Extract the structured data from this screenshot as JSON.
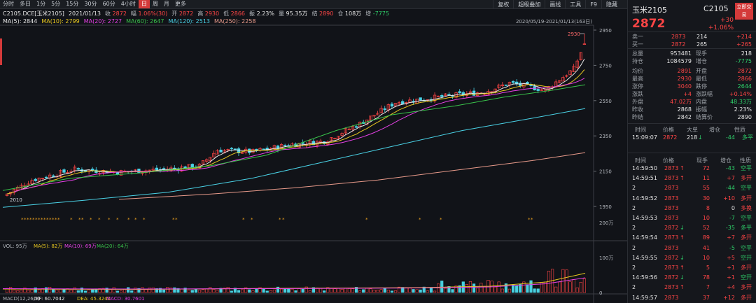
{
  "toolbar": {
    "periods": [
      "分时",
      "多日",
      "1分",
      "5分",
      "15分",
      "30分",
      "60分",
      "4小时",
      "日",
      "周",
      "月",
      "更多"
    ],
    "active_period": "日",
    "tools": [
      "复权",
      "超级叠加",
      "画线",
      "工具",
      "F9",
      "隐藏"
    ]
  },
  "quote": {
    "contract": "C2105.DCE[玉米2105]",
    "date": "2021/01/13",
    "close_label": "收",
    "close": "2872",
    "change_label": "幅",
    "change": "1.06%(30)",
    "open_label": "开",
    "open": "2872",
    "high_label": "高",
    "high": "2930",
    "low_label": "低",
    "low": "2866",
    "amp_label": "振",
    "amp": "2.23%",
    "vol_label": "量",
    "vol": "95.35万",
    "settle_label": "结",
    "settle": "2890",
    "oi_label": "仓",
    "oi": "108万",
    "oichg_label": "增",
    "oichg": "-7775"
  },
  "ma_legend": [
    "MA(5): 2844",
    "MA(10): 2799",
    "MA(20): 2727",
    "MA(60): 2647",
    "MA(120): 2513",
    "MA(250): 2258"
  ],
  "range_label": "2020/05/19-2021/01/13(163日)",
  "price_axis": [
    "2950",
    "2750",
    "2550",
    "2350",
    "2150",
    "1950"
  ],
  "annotations": {
    "high_mark": "2930",
    "low_mark": "2010"
  },
  "volume_legend": [
    "VOL: 95万",
    "MA(5): 82万",
    "MA(10): 69万",
    "MA(20): 64万"
  ],
  "volume_axis": [
    "200万",
    "100万",
    "0"
  ],
  "macd_legend": [
    "MACD(12,26,9)",
    "DIF: 60.7042",
    "DEA: 45.3241",
    "MACD: 30.7601"
  ],
  "colors": {
    "up": "#ff4545",
    "down": "#2ed06a",
    "ma5": "#e6e6e6",
    "ma10": "#e8c820",
    "ma20": "#e640e6",
    "ma60": "#39c24a",
    "ma120": "#4ad2e6",
    "ma250": "#e89a8a",
    "vol_up": "#ff4545",
    "vol_down": "#48d0e0"
  },
  "panel": {
    "name": "玉米2105",
    "code": "C2105",
    "price": "2872",
    "change": "+30",
    "change_pct": "+1.06%",
    "trade_button": "立即交易",
    "bid_ask": [
      {
        "label": "卖一",
        "price": "2873",
        "vol": "214",
        "chg": "+214"
      },
      {
        "label": "买一",
        "price": "2872",
        "vol": "265",
        "chg": "+265"
      }
    ],
    "stats_left": [
      {
        "label": "总量",
        "value": "953481",
        "cls": "white"
      },
      {
        "label": "持仓",
        "value": "1084579",
        "cls": "white"
      },
      {
        "label": "均价",
        "value": "2891",
        "cls": "red"
      },
      {
        "label": "最高",
        "value": "2930",
        "cls": "red"
      },
      {
        "label": "涨停",
        "value": "3040",
        "cls": "red"
      },
      {
        "label": "涨跌",
        "value": "+4",
        "cls": "red"
      },
      {
        "label": "外盘",
        "value": "47.02万",
        "cls": "red"
      },
      {
        "label": "昨收",
        "value": "2868",
        "cls": "white"
      },
      {
        "label": "昨结",
        "value": "2842",
        "cls": "white"
      }
    ],
    "stats_right": [
      {
        "label": "现手",
        "value": "218",
        "cls": "white"
      },
      {
        "label": "增仓",
        "value": "-7775",
        "cls": "green"
      },
      {
        "label": "开盘",
        "value": "2872",
        "cls": "red"
      },
      {
        "label": "最低",
        "value": "2866",
        "cls": "red"
      },
      {
        "label": "跌停",
        "value": "2644",
        "cls": "green"
      },
      {
        "label": "涨跌幅",
        "value": "+0.14%",
        "cls": "red"
      },
      {
        "label": "内盘",
        "value": "48.33万",
        "cls": "green"
      },
      {
        "label": "振幅",
        "value": "2.23%",
        "cls": "white"
      },
      {
        "label": "结算价",
        "value": "2890",
        "cls": "white"
      }
    ],
    "last_trade_header": [
      "时间",
      "价格",
      "大单",
      "增仓",
      "性质"
    ],
    "last_trade": {
      "time": "15:09:07",
      "price": "2872",
      "big": "218",
      "arrow": "↓",
      "chg": "-44",
      "nature": "多平"
    },
    "ticks_header": [
      "时间",
      "价格",
      "现手",
      "增仓",
      "性质"
    ],
    "ticks": [
      {
        "time": "14:59:50",
        "price": "2873",
        "arrow": "↑",
        "vol": "72",
        "chg": "-43",
        "nature": "空平",
        "pc": "red",
        "cc": "green",
        "nc": "green"
      },
      {
        "time": "14:59:51",
        "price": "2873",
        "arrow": "↑",
        "vol": "11",
        "chg": "+7",
        "nature": "多开",
        "pc": "red",
        "cc": "red",
        "nc": "red"
      },
      {
        "time": "2",
        "price": "2873",
        "arrow": "",
        "vol": "55",
        "chg": "-44",
        "nature": "空平",
        "pc": "red",
        "cc": "green",
        "nc": "green"
      },
      {
        "time": "14:59:52",
        "price": "2873",
        "arrow": "",
        "vol": "30",
        "chg": "+10",
        "nature": "多开",
        "pc": "red",
        "cc": "red",
        "nc": "red"
      },
      {
        "time": "2",
        "price": "2873",
        "arrow": "",
        "vol": "8",
        "chg": "0",
        "nature": "多换",
        "pc": "red",
        "cc": "white",
        "nc": "red"
      },
      {
        "time": "14:59:53",
        "price": "2873",
        "arrow": "",
        "vol": "10",
        "chg": "-7",
        "nature": "空平",
        "pc": "red",
        "cc": "green",
        "nc": "green"
      },
      {
        "time": "2",
        "price": "2872",
        "arrow": "↓",
        "vol": "52",
        "chg": "-35",
        "nature": "多平",
        "pc": "red",
        "cc": "green",
        "nc": "green"
      },
      {
        "time": "14:59:54",
        "price": "2873",
        "arrow": "↑",
        "vol": "89",
        "chg": "+7",
        "nature": "多开",
        "pc": "red",
        "cc": "red",
        "nc": "red"
      },
      {
        "time": "2",
        "price": "2873",
        "arrow": "",
        "vol": "41",
        "chg": "-5",
        "nature": "空平",
        "pc": "red",
        "cc": "green",
        "nc": "green"
      },
      {
        "time": "14:59:55",
        "price": "2872",
        "arrow": "↓",
        "vol": "10",
        "chg": "+5",
        "nature": "空开",
        "pc": "red",
        "cc": "red",
        "nc": "green"
      },
      {
        "time": "2",
        "price": "2873",
        "arrow": "↑",
        "vol": "5",
        "chg": "+1",
        "nature": "多开",
        "pc": "red",
        "cc": "red",
        "nc": "red"
      },
      {
        "time": "14:59:56",
        "price": "2872",
        "arrow": "↓",
        "vol": "78",
        "chg": "+1",
        "nature": "空开",
        "pc": "red",
        "cc": "red",
        "nc": "green"
      },
      {
        "time": "2",
        "price": "2873",
        "arrow": "↑",
        "vol": "7",
        "chg": "+4",
        "nature": "多开",
        "pc": "red",
        "cc": "red",
        "nc": "red"
      },
      {
        "time": "14:59:57",
        "price": "2873",
        "arrow": "",
        "vol": "37",
        "chg": "+12",
        "nature": "多开",
        "pc": "red",
        "cc": "red",
        "nc": "red"
      }
    ]
  }
}
